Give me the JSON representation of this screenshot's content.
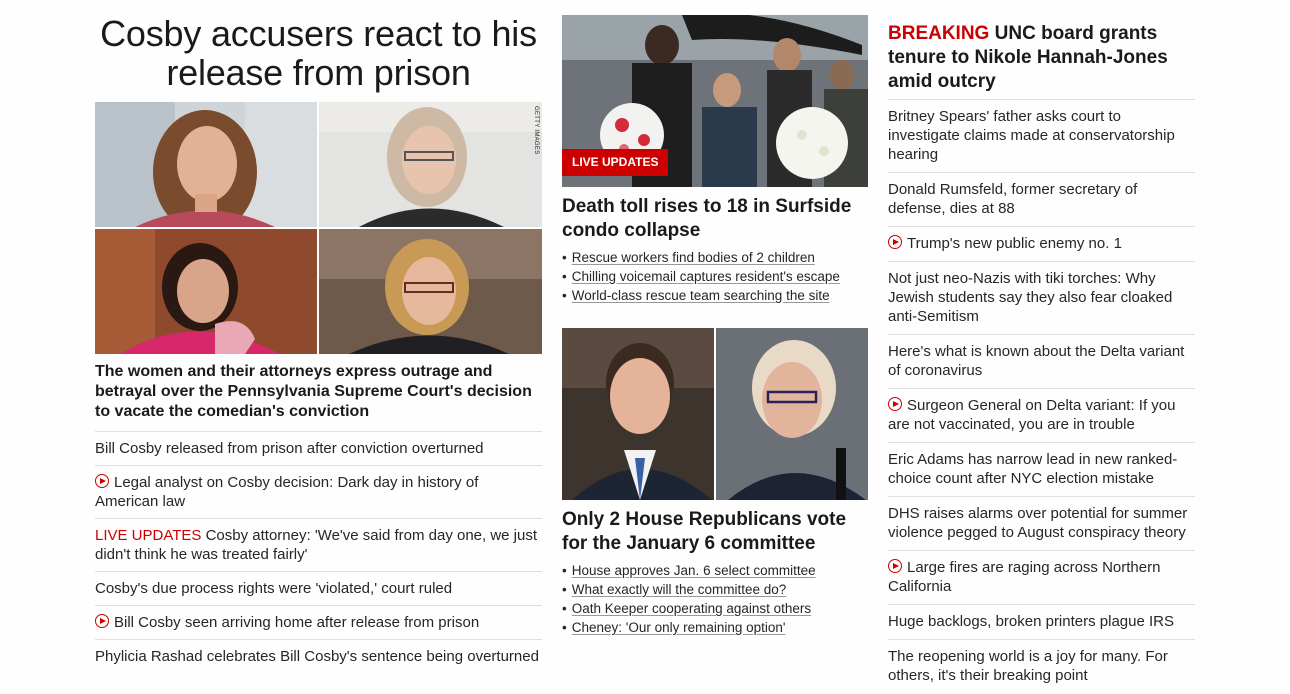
{
  "main_story": {
    "headline": "Cosby accusers react to his release from prison",
    "image_credit": "GETTY IMAGES",
    "description": "The women and their attorneys express outrage and betrayal over the Pennsylvania Supreme Court's decision to vacate the comedian's conviction",
    "links": [
      {
        "text": "Bill Cosby released from prison after conviction overturned",
        "video": false,
        "prefix": ""
      },
      {
        "text": "Legal analyst on Cosby decision: Dark day in history of American law",
        "video": true,
        "prefix": ""
      },
      {
        "text": "Cosby attorney: 'We've said from day one, we just didn't think he was treated fairly'",
        "video": false,
        "prefix": "LIVE UPDATES "
      },
      {
        "text": "Cosby's due process rights were 'violated,' court ruled",
        "video": false,
        "prefix": ""
      },
      {
        "text": "Bill Cosby seen arriving home after release from prison",
        "video": true,
        "prefix": ""
      },
      {
        "text": "Phylicia Rashad celebrates Bill Cosby's sentence being overturned",
        "video": false,
        "prefix": ""
      }
    ]
  },
  "surfside_story": {
    "badge": "LIVE UPDATES",
    "headline": "Death toll rises to 18 in Surfside condo collapse",
    "bullets": [
      "Rescue workers find bodies of 2 children",
      "Chilling voicemail captures resident's escape",
      "World-class rescue team searching the site"
    ]
  },
  "committee_story": {
    "headline": "Only 2 House Republicans vote for the January 6 committee",
    "bullets": [
      "House approves Jan. 6 select committee",
      "What exactly will the committee do?",
      "Oath Keeper cooperating against others",
      "Cheney: 'Our only remaining option'"
    ]
  },
  "right_column": {
    "breaking_label": "BREAKING",
    "breaking_headline": " UNC board grants tenure to Nikole Hannah-Jones amid outcry",
    "links": [
      {
        "text": "Britney Spears' father asks court to investigate claims made at conservatorship hearing",
        "video": false
      },
      {
        "text": "Donald Rumsfeld, former secretary of defense, dies at 88",
        "video": false
      },
      {
        "text": "Trump's new public enemy no. 1",
        "video": true
      },
      {
        "text": "Not just neo-Nazis with tiki torches: Why Jewish students say they also fear cloaked anti-Semitism",
        "video": false
      },
      {
        "text": "Here's what is known about the Delta variant of coronavirus",
        "video": false
      },
      {
        "text": "Surgeon General on Delta variant: If you are not vaccinated, you are in trouble",
        "video": true
      },
      {
        "text": "Eric Adams has narrow lead in new ranked-choice count after NYC election mistake",
        "video": false
      },
      {
        "text": "DHS raises alarms over potential for summer violence pegged to August conspiracy theory",
        "video": false
      },
      {
        "text": "Large fires are raging across Northern California",
        "video": true
      },
      {
        "text": "Huge backlogs, broken printers plague IRS",
        "video": false
      },
      {
        "text": "The reopening world is a joy for many. For others, it's their breaking point",
        "video": false
      }
    ]
  },
  "colors": {
    "accent_red": "#cc0000",
    "text": "#262626",
    "divider": "#dedede"
  }
}
